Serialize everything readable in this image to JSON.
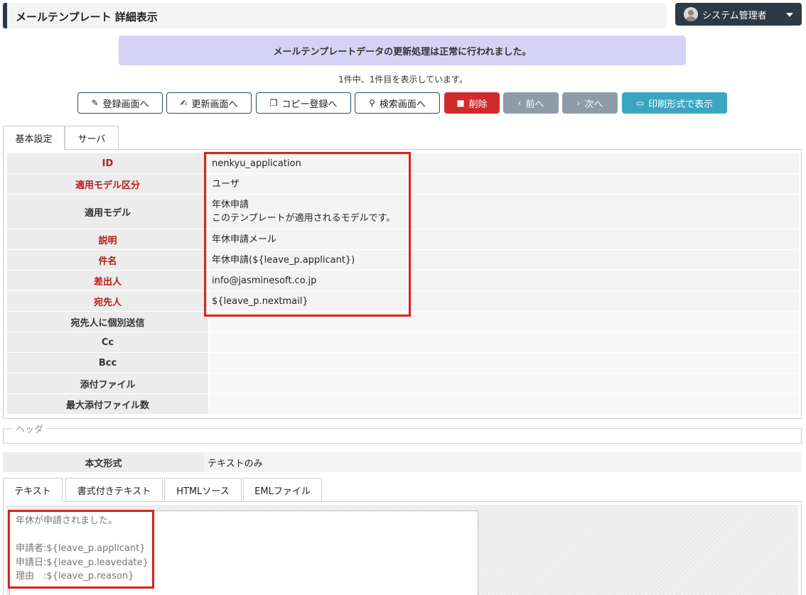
{
  "header": {
    "title": "メールテンプレート 詳細表示"
  },
  "user": {
    "name": "システム管理者"
  },
  "alert": {
    "message": "メールテンプレートデータの更新処理は正常に行われました。"
  },
  "page_info": "1件中、1件目を表示しています。",
  "toolbar": {
    "register": "登録画面へ",
    "update": "更新画面へ",
    "copy": "コピー登録へ",
    "search": "検索画面へ",
    "delete": "削除",
    "prev": "前へ",
    "next": "次へ",
    "print": "印刷形式で表示"
  },
  "tabs_main": [
    "基本設定",
    "サーバ"
  ],
  "fields": {
    "id": {
      "label": "ID",
      "value": "nenkyu_application"
    },
    "model_type": {
      "label": "適用モデル区分",
      "value": "ユーザ"
    },
    "model": {
      "label": "適用モデル",
      "value_line1": "年休申請",
      "value_line2": "このテンプレートが適用されるモデルです。"
    },
    "description": {
      "label": "説明",
      "value": "年休申請メール"
    },
    "subject": {
      "label": "件名",
      "value": "年休申請(${leave_p.applicant})"
    },
    "sender": {
      "label": "差出人",
      "value": "info@jasminesoft.co.jp"
    },
    "recipient": {
      "label": "宛先人",
      "value": "${leave_p.nextmail}"
    },
    "individual_send": {
      "label": "宛先人に個別送信",
      "value": ""
    },
    "cc": {
      "label": "Cc",
      "value": ""
    },
    "bcc": {
      "label": "Bcc",
      "value": ""
    },
    "attachment": {
      "label": "添付ファイル",
      "value": ""
    },
    "max_attachments": {
      "label": "最大添付ファイル数",
      "value": ""
    }
  },
  "header_section": {
    "legend": "ヘッダ"
  },
  "body_format": {
    "label": "本文形式",
    "value": "テキストのみ"
  },
  "tabs_body": [
    "テキスト",
    "書式付きテキスト",
    "HTMLソース",
    "EMLファイル"
  ],
  "body_text": "年休が申請されました。\n\n申請者:${leave_p.applicant}\n申請日:${leave_p.leavedate}\n理由　:${leave_p.reason}",
  "colors": {
    "header_accent": "#2d3a45",
    "alert_bg": "#d6d2f5",
    "required_label": "#b51c1c",
    "delete_button": "#d02a2a",
    "nav_button": "#8f9ba8",
    "print_button": "#3aa6c2",
    "highlight_box": "#e02020"
  }
}
